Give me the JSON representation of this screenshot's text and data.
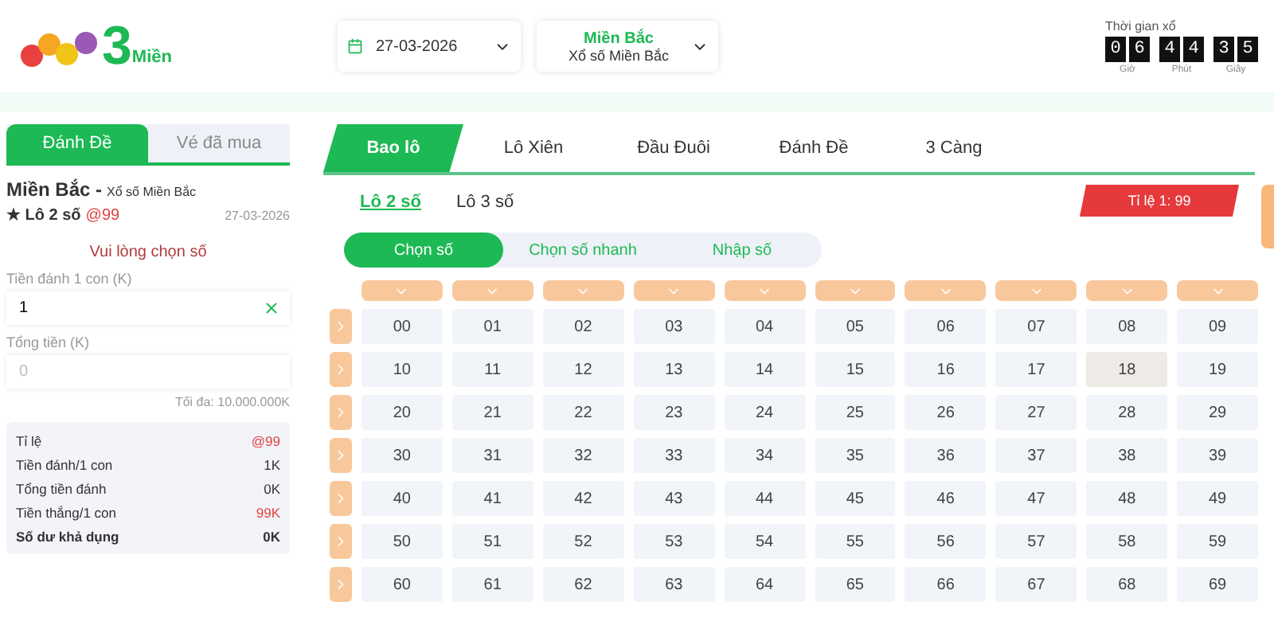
{
  "header": {
    "logo": {
      "digit": "3",
      "word": "Miền"
    },
    "date_picker": {
      "value": "27-03-2026"
    },
    "region_select": {
      "title": "Miền Bắc",
      "subtitle": "Xổ số Miền Bắc"
    },
    "countdown": {
      "label": "Thời gian xổ",
      "units": [
        {
          "digits": [
            "0",
            "6"
          ],
          "label": "Giờ"
        },
        {
          "digits": [
            "4",
            "4"
          ],
          "label": "Phút"
        },
        {
          "digits": [
            "3",
            "5"
          ],
          "label": "Giây"
        }
      ]
    }
  },
  "sidebar": {
    "tabs": [
      {
        "label": "Đánh Đề",
        "selected": true
      },
      {
        "label": "Vé đã mua",
        "selected": false
      }
    ],
    "region": "Miền Bắc -",
    "region_sub": "Xổ số Miền Bắc",
    "bet_type": "★ Lô 2 số",
    "bet_rate": "@99",
    "date": "27-03-2026",
    "notice": "Vui lòng chọn số",
    "stake_field": {
      "label": "Tiền đánh 1 con (K)",
      "value": "1"
    },
    "total_field": {
      "label": "Tổng tiền (K)",
      "placeholder": "0"
    },
    "max_note": "Tối đa: 10.000.000K",
    "summary": [
      {
        "label": "Tỉ lệ",
        "value": "@99",
        "kind": "accent"
      },
      {
        "label": "Tiền đánh/1 con",
        "value": "1K",
        "kind": "plain"
      },
      {
        "label": "Tổng tiền đánh",
        "value": "0K",
        "kind": "plain"
      },
      {
        "label": "Tiền thắng/1 con",
        "value": "99K",
        "kind": "accent"
      },
      {
        "label": "Số dư khả dụng",
        "value": "0K",
        "kind": "bold"
      }
    ]
  },
  "main": {
    "tabs": [
      {
        "label": "Bao lô",
        "selected": true
      },
      {
        "label": "Lô Xiên",
        "selected": false
      },
      {
        "label": "Đầu Đuôi",
        "selected": false
      },
      {
        "label": "Đánh Đề",
        "selected": false
      },
      {
        "label": "3 Càng",
        "selected": false
      }
    ],
    "subtabs": [
      {
        "label": "Lô 2 số",
        "selected": true
      },
      {
        "label": "Lô 3 số",
        "selected": false
      }
    ],
    "rate_badge": "Tỉ lệ 1: 99",
    "modes": [
      {
        "label": "Chọn số",
        "selected": true
      },
      {
        "label": "Chọn số nhanh",
        "selected": false
      },
      {
        "label": "Nhập số",
        "selected": false
      }
    ],
    "grid": [
      {
        "cells": [
          {
            "label": "00",
            "highlighted": false
          },
          {
            "label": "01",
            "highlighted": false
          },
          {
            "label": "02",
            "highlighted": false
          },
          {
            "label": "03",
            "highlighted": false
          },
          {
            "label": "04",
            "highlighted": false
          },
          {
            "label": "05",
            "highlighted": false
          },
          {
            "label": "06",
            "highlighted": false
          },
          {
            "label": "07",
            "highlighted": false
          },
          {
            "label": "08",
            "highlighted": false
          },
          {
            "label": "09",
            "highlighted": false
          }
        ]
      },
      {
        "cells": [
          {
            "label": "10",
            "highlighted": false
          },
          {
            "label": "11",
            "highlighted": false
          },
          {
            "label": "12",
            "highlighted": false
          },
          {
            "label": "13",
            "highlighted": false
          },
          {
            "label": "14",
            "highlighted": false
          },
          {
            "label": "15",
            "highlighted": false
          },
          {
            "label": "16",
            "highlighted": false
          },
          {
            "label": "17",
            "highlighted": false
          },
          {
            "label": "18",
            "highlighted": true
          },
          {
            "label": "19",
            "highlighted": false
          }
        ]
      },
      {
        "cells": [
          {
            "label": "20",
            "highlighted": false
          },
          {
            "label": "21",
            "highlighted": false
          },
          {
            "label": "22",
            "highlighted": false
          },
          {
            "label": "23",
            "highlighted": false
          },
          {
            "label": "24",
            "highlighted": false
          },
          {
            "label": "25",
            "highlighted": false
          },
          {
            "label": "26",
            "highlighted": false
          },
          {
            "label": "27",
            "highlighted": false
          },
          {
            "label": "28",
            "highlighted": false
          },
          {
            "label": "29",
            "highlighted": false
          }
        ]
      },
      {
        "cells": [
          {
            "label": "30",
            "highlighted": false
          },
          {
            "label": "31",
            "highlighted": false
          },
          {
            "label": "32",
            "highlighted": false
          },
          {
            "label": "33",
            "highlighted": false
          },
          {
            "label": "34",
            "highlighted": false
          },
          {
            "label": "35",
            "highlighted": false
          },
          {
            "label": "36",
            "highlighted": false
          },
          {
            "label": "37",
            "highlighted": false
          },
          {
            "label": "38",
            "highlighted": false
          },
          {
            "label": "39",
            "highlighted": false
          }
        ]
      },
      {
        "cells": [
          {
            "label": "40",
            "highlighted": false
          },
          {
            "label": "41",
            "highlighted": false
          },
          {
            "label": "42",
            "highlighted": false
          },
          {
            "label": "43",
            "highlighted": false
          },
          {
            "label": "44",
            "highlighted": false
          },
          {
            "label": "45",
            "highlighted": false
          },
          {
            "label": "46",
            "highlighted": false
          },
          {
            "label": "47",
            "highlighted": false
          },
          {
            "label": "48",
            "highlighted": false
          },
          {
            "label": "49",
            "highlighted": false
          }
        ]
      },
      {
        "cells": [
          {
            "label": "50",
            "highlighted": false
          },
          {
            "label": "51",
            "highlighted": false
          },
          {
            "label": "52",
            "highlighted": false
          },
          {
            "label": "53",
            "highlighted": false
          },
          {
            "label": "54",
            "highlighted": false
          },
          {
            "label": "55",
            "highlighted": false
          },
          {
            "label": "56",
            "highlighted": false
          },
          {
            "label": "57",
            "highlighted": false
          },
          {
            "label": "58",
            "highlighted": false
          },
          {
            "label": "59",
            "highlighted": false
          }
        ]
      },
      {
        "cells": [
          {
            "label": "60",
            "highlighted": false
          },
          {
            "label": "61",
            "highlighted": false
          },
          {
            "label": "62",
            "highlighted": false
          },
          {
            "label": "63",
            "highlighted": false
          },
          {
            "label": "64",
            "highlighted": false
          },
          {
            "label": "65",
            "highlighted": false
          },
          {
            "label": "66",
            "highlighted": false
          },
          {
            "label": "67",
            "highlighted": false
          },
          {
            "label": "68",
            "highlighted": false
          },
          {
            "label": "69",
            "highlighted": false
          }
        ]
      }
    ]
  }
}
